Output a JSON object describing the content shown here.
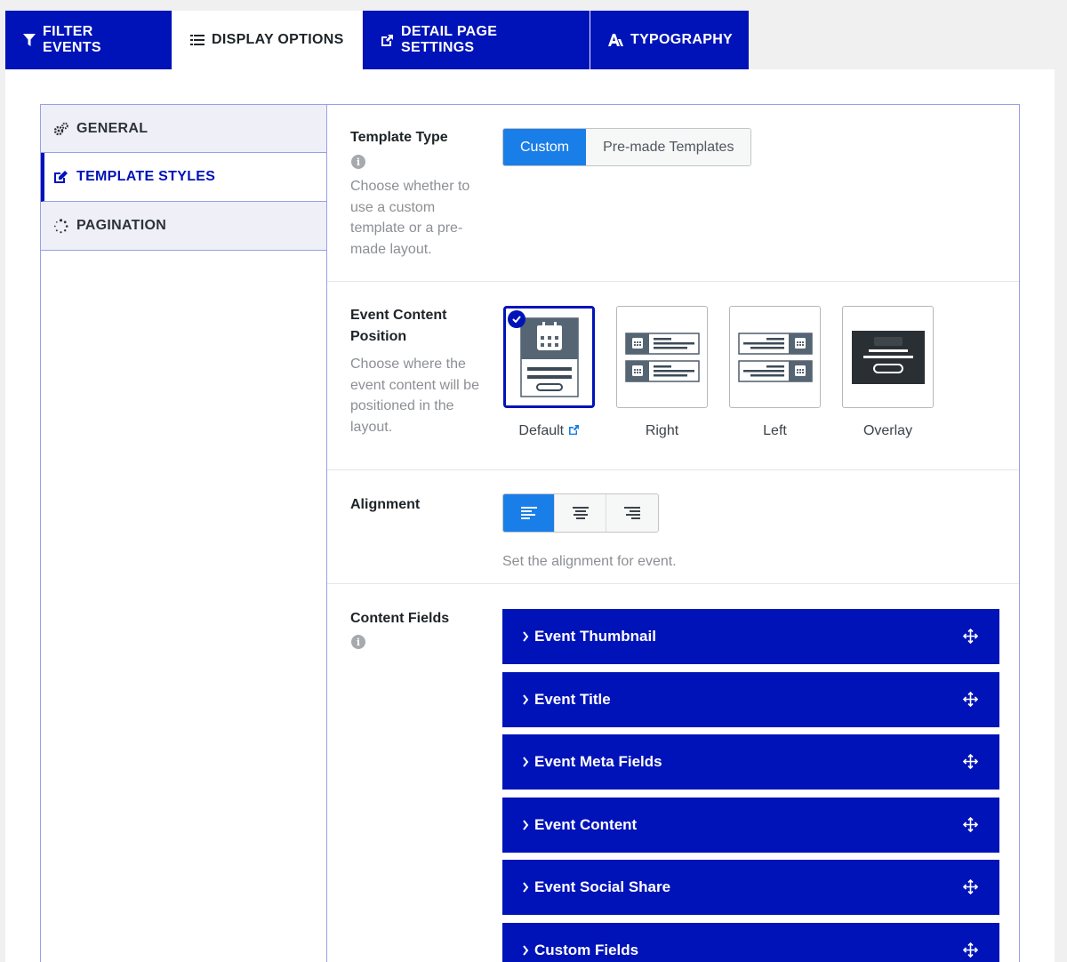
{
  "tabs": [
    {
      "label": "FILTER EVENTS",
      "icon": "filter-icon"
    },
    {
      "label": "DISPLAY OPTIONS",
      "icon": "list-icon",
      "active": true
    },
    {
      "label": "DETAIL PAGE SETTINGS",
      "icon": "external-link-icon"
    },
    {
      "label": "TYPOGRAPHY",
      "icon": "typography-icon"
    }
  ],
  "subnav": [
    {
      "label": "GENERAL",
      "icon": "gears-icon"
    },
    {
      "label": "TEMPLATE STYLES",
      "icon": "edit-icon",
      "active": true
    },
    {
      "label": "PAGINATION",
      "icon": "spinner-icon"
    }
  ],
  "template_type": {
    "label": "Template Type",
    "description": "Choose whether to use a custom template or a pre-made layout.",
    "options": [
      "Custom",
      "Pre-made Templates"
    ],
    "selected": "Custom"
  },
  "content_position": {
    "label": "Event Content Position",
    "description": "Choose where the event content will be positioned in the layout.",
    "options": [
      "Default",
      "Right",
      "Left",
      "Overlay"
    ],
    "selected": "Default"
  },
  "alignment": {
    "label": "Alignment",
    "description": "Set the alignment for event.",
    "options": [
      "align-left-icon",
      "align-center-icon",
      "align-right-icon"
    ],
    "selected": "align-left-icon"
  },
  "content_fields": {
    "label": "Content Fields",
    "items": [
      "Event Thumbnail",
      "Event Title",
      "Event Meta Fields",
      "Event Content",
      "Event Social Share",
      "Custom Fields"
    ]
  },
  "colors": {
    "primary": "#0013b8",
    "accent": "#1a7ee8",
    "background": "#f0f0f1"
  }
}
